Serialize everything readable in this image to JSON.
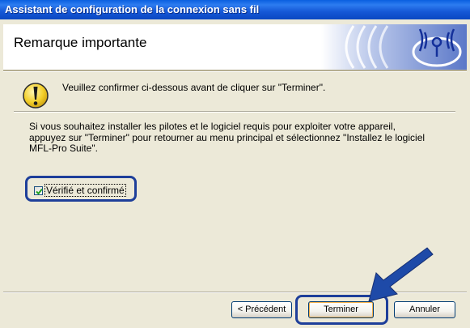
{
  "window": {
    "title": "Assistant de configuration de la connexion sans fil"
  },
  "header": {
    "title": "Remarque importante",
    "logo_icon": "wireless-signal-icon"
  },
  "notice": {
    "icon": "warning-exclamation-icon",
    "text": "Veuillez confirmer ci-dessous avant de cliquer sur \"Terminer\"."
  },
  "body": {
    "line1": "Si vous souhaitez installer les pilotes et le logiciel requis pour exploiter votre appareil,",
    "line2": "appuyez sur \"Terminer\" pour retourner au menu principal et sélectionnez \"Installez le logiciel",
    "line3": "MFL-Pro Suite\"."
  },
  "checkbox": {
    "label": "Vérifié et confirmé",
    "checked": true
  },
  "buttons": {
    "back": "< Précédent",
    "finish": "Terminer",
    "cancel": "Annuler"
  },
  "colors": {
    "titlebar": "#0a5fe0",
    "highlight_border": "#1e3f9a",
    "arrow": "#1e4aa8",
    "dialog_bg": "#ece9d8"
  }
}
